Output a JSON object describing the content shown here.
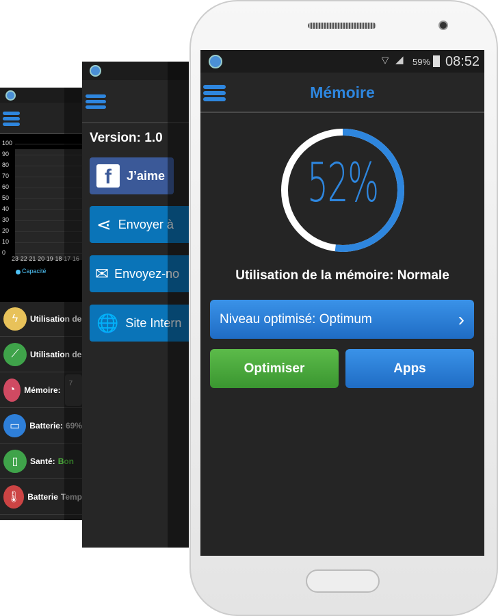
{
  "screen_stats": {
    "chart_data": {
      "type": "line",
      "y_ticks": [
        "100",
        "90",
        "80",
        "70",
        "60",
        "50",
        "40",
        "30",
        "20",
        "10",
        "0"
      ],
      "x_ticks": [
        "23",
        "22",
        "21",
        "20",
        "19",
        "18",
        "17",
        "16"
      ],
      "ylim": [
        0,
        100
      ],
      "legend": "Capacité",
      "legend_color": "#4fc3f7",
      "series": [
        {
          "name": "Capacité",
          "values": []
        }
      ],
      "grid": true
    },
    "rows": [
      {
        "icon": "lightning-icon",
        "color": "#e8c25a",
        "label": "Utilisation de"
      },
      {
        "icon": "chart-line-icon",
        "color": "#3fa34a",
        "label": "Utilisation de"
      },
      {
        "icon": "pie-chart-icon",
        "color": "#d04a62",
        "label": "Mémoire:",
        "extra": "7"
      },
      {
        "icon": "battery-icon",
        "color": "#2e7fd9",
        "label": "Batterie:",
        "value": "69%"
      },
      {
        "icon": "tablet-icon",
        "color": "#3fa34a",
        "label": "Santé:",
        "value": "Bon"
      },
      {
        "icon": "thermometer-icon",
        "color": "#cc4444",
        "label": "Batterie",
        "value": "Temp"
      }
    ]
  },
  "screen_about": {
    "version": "Version: 1.0",
    "buttons": [
      {
        "icon": "facebook-icon",
        "label": "J’aime"
      },
      {
        "icon": "share-icon",
        "label": "Envoyer à"
      },
      {
        "icon": "mail-icon",
        "label": "Envoyez-no"
      },
      {
        "icon": "globe-icon",
        "label": "Site Intern"
      }
    ]
  },
  "status_bar": {
    "battery": "59%",
    "time": "08:52"
  },
  "header": {
    "title": "Mémoire"
  },
  "memory": {
    "percent_label": "52%",
    "percent": 52,
    "usage_text": "Utilisation de la mémoire: Normale"
  },
  "level_button": {
    "label": "Niveau optimisé: Optimum"
  },
  "optimize_button": {
    "label": "Optimiser"
  },
  "apps_button": {
    "label": "Apps"
  },
  "colors": {
    "accent": "#2e86de",
    "green": "#4caf3c",
    "background": "#252525"
  }
}
